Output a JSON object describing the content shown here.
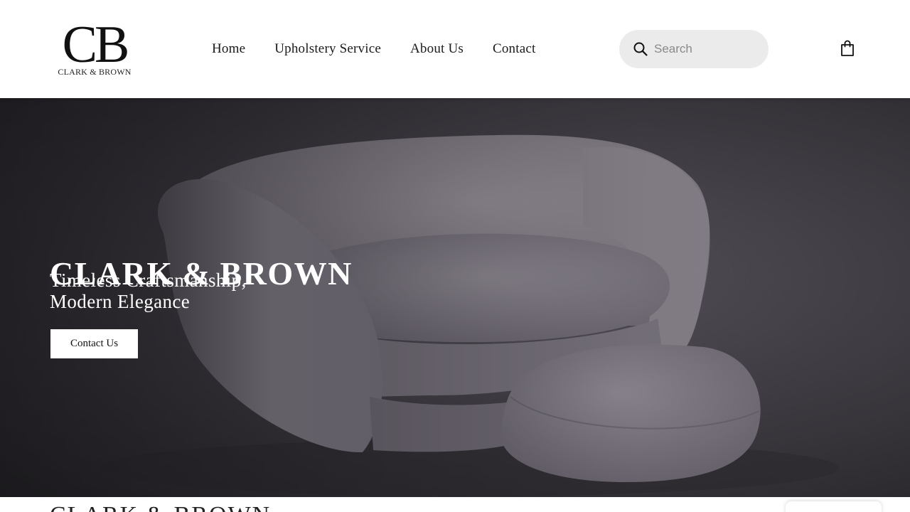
{
  "header": {
    "logo": {
      "mark": "CB",
      "text": "CLARK & BROWN"
    },
    "nav": [
      {
        "label": "Home"
      },
      {
        "label": "Upholstery Service"
      },
      {
        "label": "About Us"
      },
      {
        "label": "Contact"
      }
    ],
    "search": {
      "placeholder": "Search",
      "icon": "search-icon"
    },
    "cart": {
      "icon": "shopping-bag-icon"
    }
  },
  "hero": {
    "brand": "CLARK & BROWN",
    "tagline_line1": "Timeless Craftsmanship,",
    "tagline_line2": "Modern Elegance",
    "cta_label": "Contact Us"
  },
  "below": {
    "title": "CLARK & BROWN"
  },
  "colors": {
    "header_bg": "#ffffff",
    "hero_bg": "#403d44",
    "sofa": "#8a858c",
    "text_dark": "#1a1a1a",
    "search_bg": "#ebebeb"
  }
}
